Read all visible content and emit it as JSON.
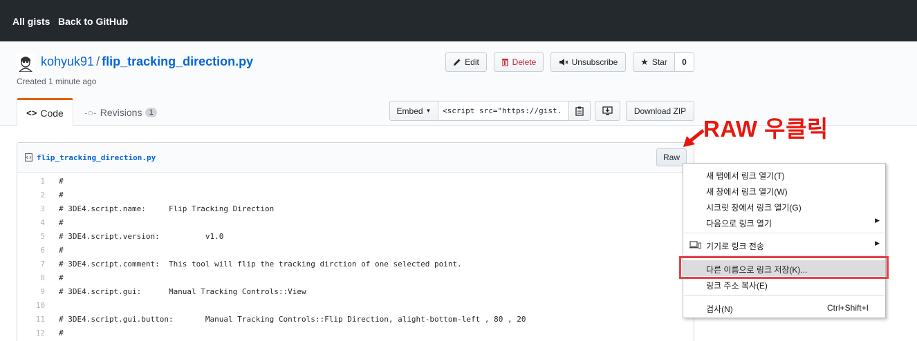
{
  "topbar": {
    "all_gists": "All gists",
    "back": "Back to GitHub"
  },
  "gist": {
    "owner": "kohyuk91",
    "separator": "/",
    "filename": "flip_tracking_direction.py",
    "created": "Created 1 minute ago"
  },
  "actions": {
    "edit": "Edit",
    "delete": "Delete",
    "unsubscribe": "Unsubscribe",
    "star": "Star",
    "star_count": "0"
  },
  "tabs": {
    "code": "Code",
    "revisions": "Revisions",
    "revisions_count": "1"
  },
  "embed": {
    "label": "Embed",
    "value": "<script src=\"https://gist.",
    "download": "Download ZIP"
  },
  "file": {
    "name": "flip_tracking_direction.py",
    "raw": "Raw",
    "lines": [
      {
        "n": "1",
        "text": "#"
      },
      {
        "n": "2",
        "text": "#"
      },
      {
        "n": "3",
        "text": "# 3DE4.script.name:     Flip Tracking Direction"
      },
      {
        "n": "4",
        "text": "#"
      },
      {
        "n": "5",
        "text": "# 3DE4.script.version:          v1.0"
      },
      {
        "n": "6",
        "text": "#"
      },
      {
        "n": "7",
        "text": "# 3DE4.script.comment:  This tool will flip the tracking dirction of one selected point."
      },
      {
        "n": "8",
        "text": "#"
      },
      {
        "n": "9",
        "text": "# 3DE4.script.gui:      Manual Tracking Controls::View"
      },
      {
        "n": "10",
        "text": ""
      },
      {
        "n": "11",
        "text": "# 3DE4.script.gui.button:       Manual Tracking Controls::Flip Direction, alight-bottom-left , 80 , 20"
      },
      {
        "n": "12",
        "text": "#"
      }
    ]
  },
  "annotation": {
    "text": "RAW 우클릭",
    "color": "#e8170f"
  },
  "context_menu": {
    "items": [
      {
        "label": "새 탭에서 링크 열기(T)"
      },
      {
        "label": "새 창에서 링크 열기(W)"
      },
      {
        "label": "시크릿 창에서 링크 열기(G)"
      },
      {
        "label": "다음으로 링크 열기",
        "submenu": "▶"
      },
      {
        "label": "기기로 링크 전송",
        "submenu": "▶",
        "icon": "devices-icon"
      },
      {
        "label": "다른 이름으로 링크 저장(K)..."
      },
      {
        "label": "링크 주소 복사(E)"
      },
      {
        "label": "검사(N)",
        "shortcut": "Ctrl+Shift+I"
      }
    ]
  },
  "colors": {
    "topbar": "#24292e",
    "link": "#0366d6",
    "highlight": "#e5404a"
  }
}
